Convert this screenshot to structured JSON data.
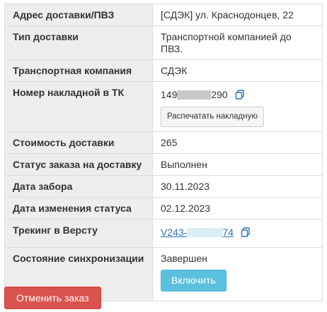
{
  "rows": {
    "address": {
      "label": "Адрес доставки/ПВЗ",
      "value": "[СДЭК] ул. Краснодонцев, 22"
    },
    "delivery_type": {
      "label": "Тип доставки",
      "value": "Транспортной компанией до ПВЗ."
    },
    "carrier": {
      "label": "Транспортная компания",
      "value": "СДЭК"
    },
    "waybill": {
      "label": "Номер накладной в ТК",
      "value_prefix": "149",
      "value_suffix": "290",
      "print_button": "Распечатать накладную"
    },
    "cost": {
      "label": "Стоимость доставки",
      "value": "265"
    },
    "order_status": {
      "label": "Статус заказа на доставку",
      "value": "Выполнен"
    },
    "pickup_date": {
      "label": "Дата забора",
      "value": "30.11.2023"
    },
    "status_change_date": {
      "label": "Дата изменения статуса",
      "value": "02.12.2023"
    },
    "tracking": {
      "label": "Трекинг в Версту",
      "value_prefix": "V243-",
      "value_suffix": "74"
    },
    "sync_state": {
      "label": "Состояние синхронизации",
      "value": "Завершен",
      "enable_button": "Включить"
    }
  },
  "cancel_button": "Отменить заказ",
  "icons": {
    "copy": "copy-icon"
  },
  "colors": {
    "danger": "#d9534f",
    "info": "#5bc0de",
    "link": "#2a6fb0"
  }
}
